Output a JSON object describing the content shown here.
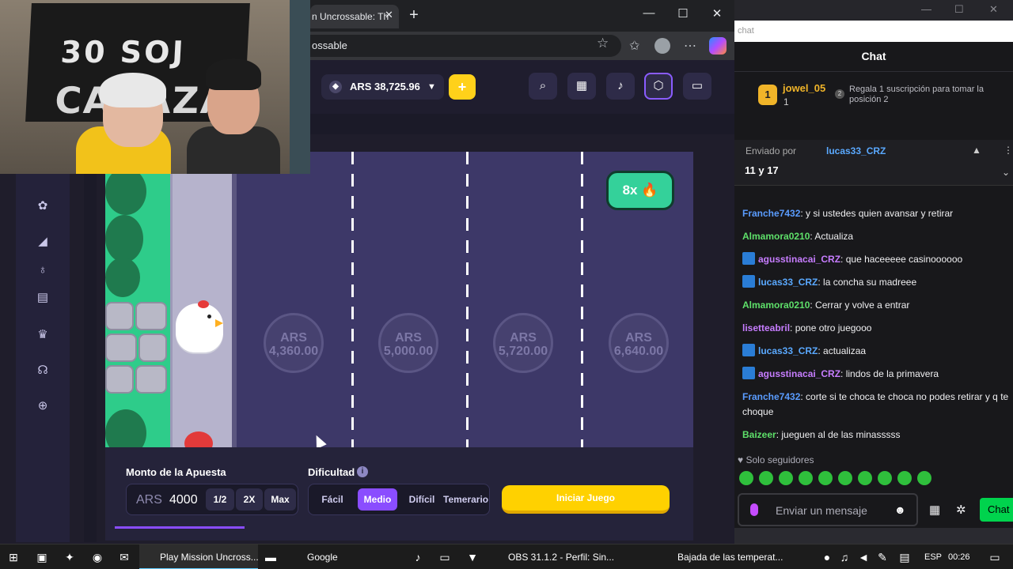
{
  "browser": {
    "tab_title": "n Uncrossable: Th",
    "url": "ossable",
    "window_controls": [
      "—",
      "☐",
      "✕"
    ]
  },
  "site": {
    "balance": "ARS 38,725.96",
    "deposit_label": "+"
  },
  "game": {
    "lane_values": [
      {
        "currency": "ARS",
        "amount": "4,360.00"
      },
      {
        "currency": "ARS",
        "amount": "5,000.00"
      },
      {
        "currency": "ARS",
        "amount": "5,720.00"
      },
      {
        "currency": "ARS",
        "amount": "6,640.00"
      }
    ],
    "multiplier_badge": "8x 🔥"
  },
  "bet_panel": {
    "amount_label": "Monto de la Apuesta",
    "currency": "ARS",
    "amount_value": "4000",
    "half_label": "1/2",
    "double_label": "2X",
    "max_label": "Max",
    "difficulty_label": "Dificultad",
    "difficulties": [
      "Fácil",
      "Medio",
      "Difícil",
      "Temerario"
    ],
    "selected_difficulty": "Medio",
    "start_label": "Iniciar Juego"
  },
  "webcam": {
    "banner_line1": "30 SOJ",
    "banner_line2": "CARAZA"
  },
  "chat": {
    "search_placeholder": "chat",
    "title": "Chat",
    "hype": {
      "rank": "1",
      "user": "jowel_05",
      "count": "1",
      "position_number": "2",
      "text": "Regala 1 suscripción para tomar la posición 2"
    },
    "pinned": {
      "label": "Enviado por",
      "user": "lucas33_CRZ",
      "text": "11 y 17"
    },
    "messages": [
      {
        "user": "Franche7432",
        "text": ": y si ustedes quien avansar y retirar",
        "color": "#5a9cff",
        "badge": false
      },
      {
        "user": "Almamora0210",
        "text": ": Actualiza",
        "color": "#5ee06a",
        "badge": false
      },
      {
        "user": "agusstinacai_CRZ",
        "text": ": que haceeeee casinoooooo",
        "color": "#c77dff",
        "badge": true
      },
      {
        "user": "lucas33_CRZ",
        "text": ": la concha su madreee",
        "color": "#5aa9ff",
        "badge": true
      },
      {
        "user": "Almamora0210",
        "text": ": Cerrar y volve a entrar",
        "color": "#5ee06a",
        "badge": false
      },
      {
        "user": "lisetteabril",
        "text": ": pone otro juegooo",
        "color": "#c77dff",
        "badge": false
      },
      {
        "user": "lucas33_CRZ",
        "text": ": actualizaa",
        "color": "#5aa9ff",
        "badge": true
      },
      {
        "user": "agusstinacai_CRZ",
        "text": ": lindos de la primavera",
        "color": "#c77dff",
        "badge": true
      },
      {
        "user": "Franche7432",
        "text": ": corte si te choca te choca no podes retirar y q te choque",
        "color": "#5a9cff",
        "badge": false
      },
      {
        "user": "Baizeer",
        "text": ": jueguen al de las minasssss",
        "color": "#5ee06a",
        "badge": false
      }
    ],
    "followers_only": "Solo seguidores",
    "input_placeholder": "Enviar un mensaje",
    "send_label": "Chat"
  },
  "taskbar": {
    "items": [
      "Play Mission Uncross...",
      "Google",
      "OBS 31.1.2 - Perfil: Sin...",
      "Bajada de las temperat..."
    ],
    "language": "ESP",
    "time": "00:26"
  },
  "colors": {
    "accent_purple": "#8a4dff",
    "start_yellow": "#ffd100",
    "multiplier_green": "#34d19a",
    "chat_send_green": "#00d34d"
  }
}
